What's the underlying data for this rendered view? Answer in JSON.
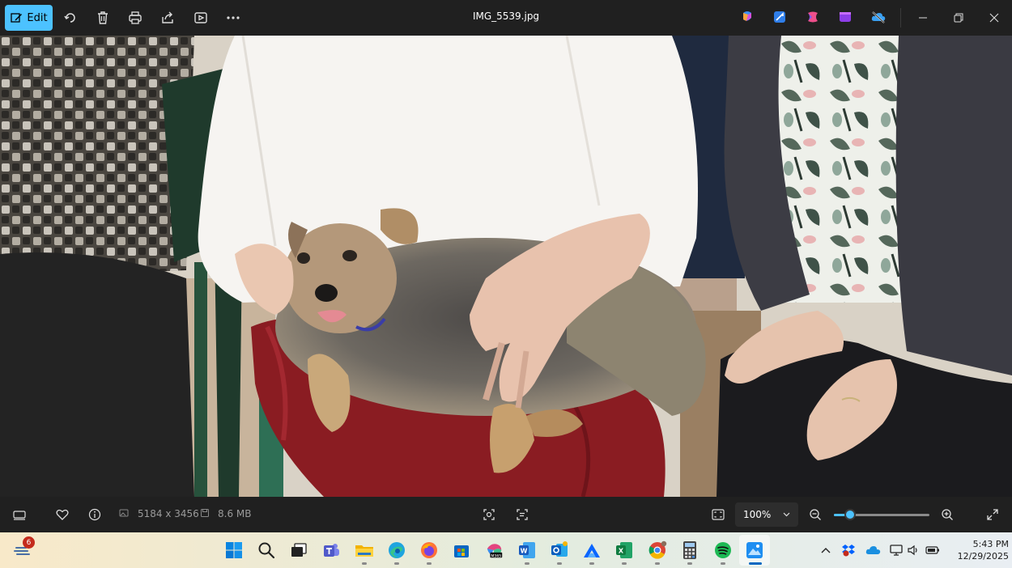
{
  "app": {
    "file_name": "IMG_5539.jpg",
    "edit_label": "Edit"
  },
  "toolbar": {
    "icons": [
      "edit-icon",
      "rotate-icon",
      "delete-icon",
      "print-icon",
      "share-icon",
      "slideshow-icon",
      "more-icon"
    ]
  },
  "extensions": {
    "icons": [
      "copilot-icon",
      "clipchamp-icon",
      "designer-icon",
      "video-editor-icon",
      "cloud-sync-off-icon"
    ]
  },
  "info_bar": {
    "dimensions": "5184 x 3456",
    "file_size": "8.6 MB",
    "zoom": "100%",
    "zoom_fraction": 0.17
  },
  "taskbar": {
    "notification_count": "6",
    "apps": [
      "start",
      "search",
      "task-view",
      "teams",
      "file-explorer",
      "edge",
      "firefox",
      "store",
      "microsoft-365",
      "word",
      "outlook",
      "app",
      "excel",
      "chrome",
      "calculator",
      "spotify",
      "photos"
    ],
    "time": "5:43 PM",
    "date": "12/29/2025"
  },
  "colors": {
    "accent": "#4cc2ff",
    "titlebar": "#202020",
    "taskbar_active": "#0067c0"
  }
}
